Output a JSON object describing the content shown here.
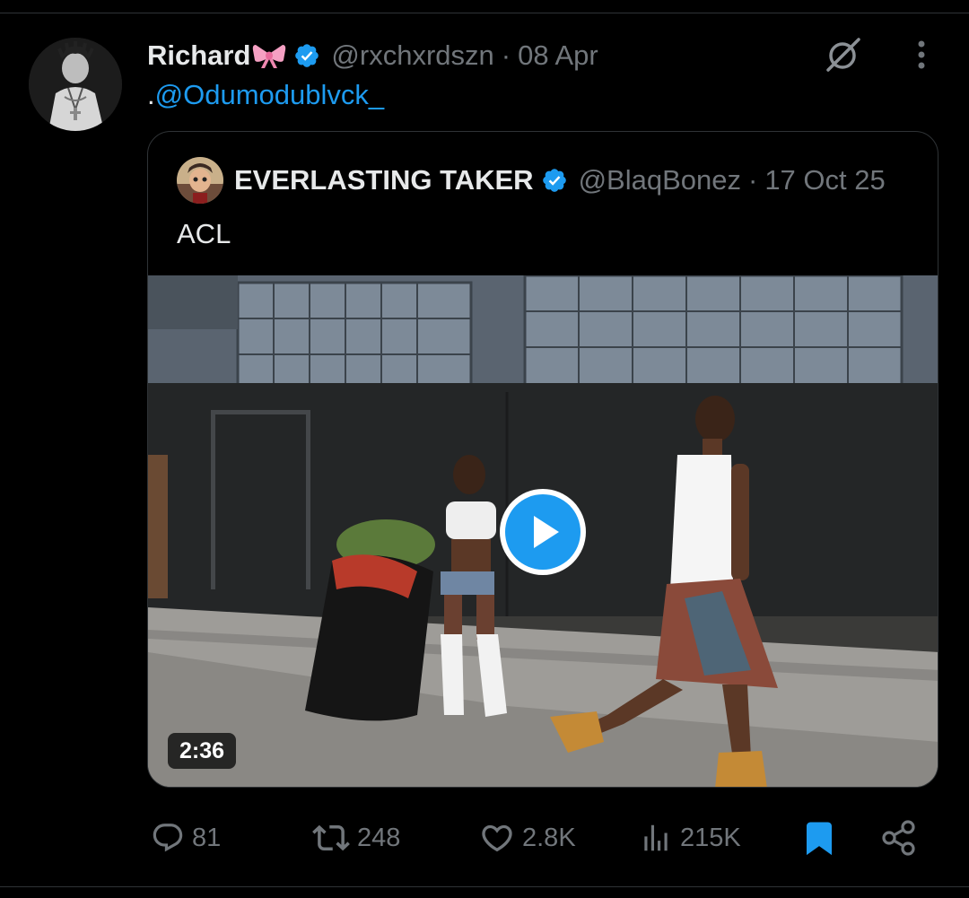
{
  "tweet": {
    "author_name": "Richard",
    "author_handle": "@rxchxrdszn",
    "separator": "·",
    "date": "08 Apr",
    "text_prefix": ".",
    "mention": "@Odumodublvck_"
  },
  "quoted_tweet": {
    "author_name": "EVERLASTING TAKER",
    "author_handle": "@BlaqBonez",
    "separator": "·",
    "date": "17 Oct 25",
    "text": "ACL",
    "video_duration": "2:36"
  },
  "actions": {
    "replies": "81",
    "reposts": "248",
    "likes": "2.8K",
    "views": "215K"
  },
  "icons": {
    "verified": "verified-badge-icon",
    "bow": "ribbon-bow-emoji",
    "grok": "grok-icon",
    "more": "more-options-icon",
    "play": "play-icon",
    "reply": "reply-icon",
    "repost": "repost-icon",
    "like": "heart-icon",
    "views": "views-icon",
    "bookmark": "bookmark-icon",
    "share": "share-icon"
  },
  "colors": {
    "background": "#000000",
    "text": "#e7e9ea",
    "secondary_text": "#71767b",
    "accent": "#1d9bf0",
    "border": "#2f3336",
    "bow": "#f5a0c3"
  }
}
